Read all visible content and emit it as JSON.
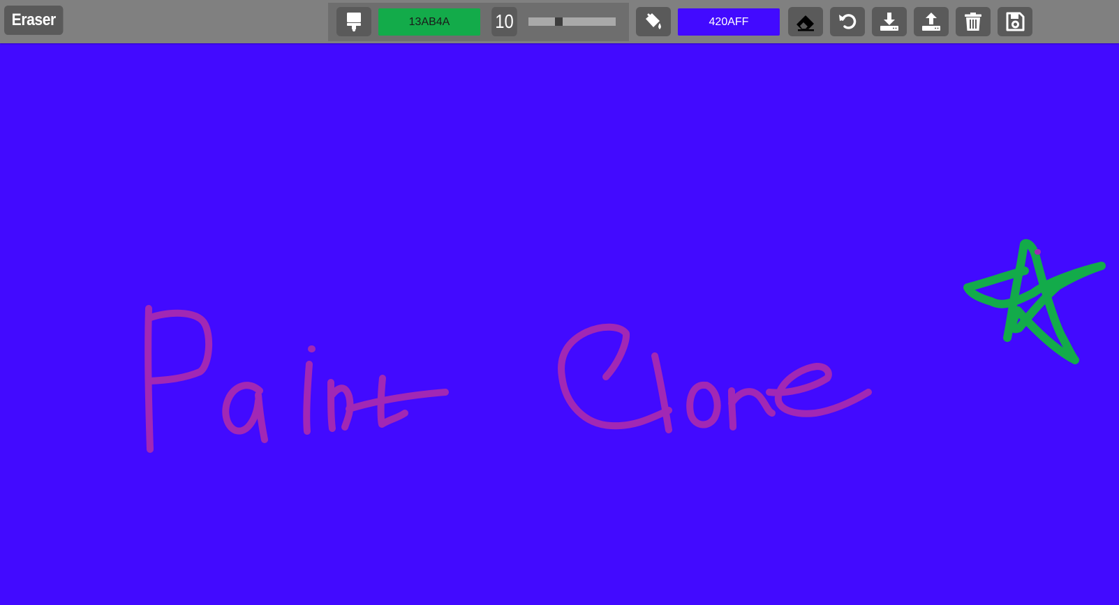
{
  "toolbar": {
    "mode_label": "Eraser",
    "brush_color_hex": "13AB4A",
    "brush_size": "10",
    "brush_size_slider": {
      "min": 1,
      "max": 50,
      "value": 10
    },
    "bucket_color_hex": "420AFF"
  },
  "icons": {
    "brush": "paint-brush-icon",
    "bucket": "fill-bucket-icon",
    "eraser": "eraser-icon",
    "undo": "undo-icon",
    "download": "download-icon",
    "upload": "upload-icon",
    "clear": "trash-icon",
    "save": "save-icon"
  },
  "colors": {
    "toolbar_bg": "#808080",
    "button_bg": "#5a5a5a",
    "canvas_bg": "#420AFF",
    "brush_color": "#13AB4A",
    "text_stroke": "#A228B4"
  },
  "canvas": {
    "strokes": [
      {
        "name": "text-paint",
        "color": "#A228B4"
      },
      {
        "name": "text-clone",
        "color": "#A228B4"
      },
      {
        "name": "star",
        "color": "#13AB4A"
      }
    ]
  }
}
